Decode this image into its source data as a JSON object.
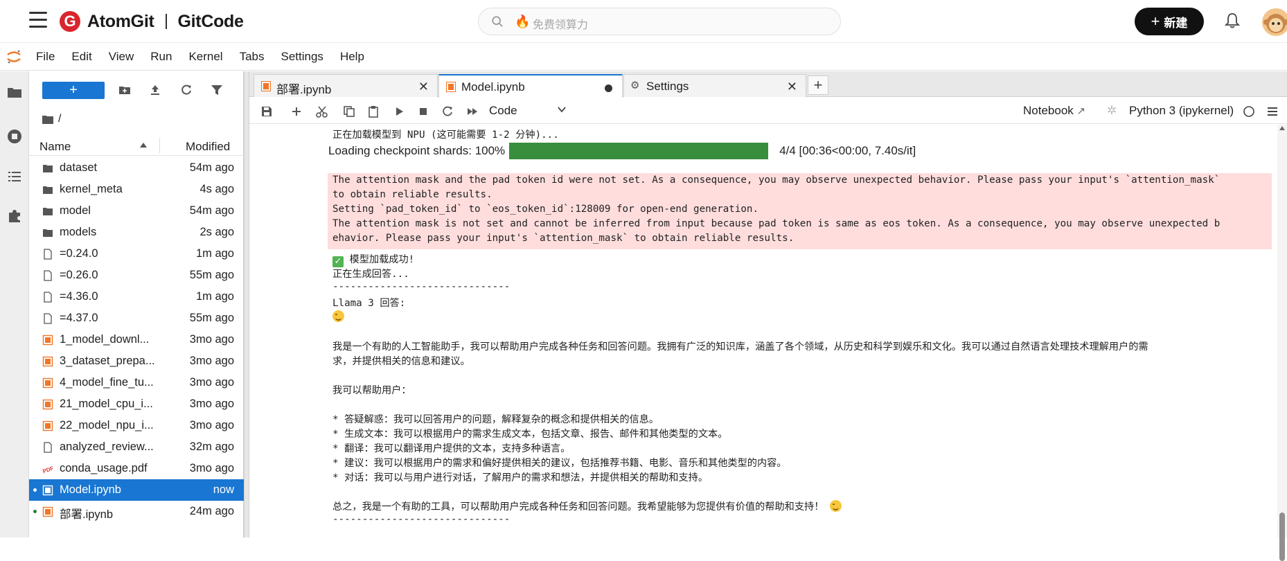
{
  "brand": {
    "name1": "AtomGit",
    "name2": "GitCode",
    "search_placeholder": "免费领算力",
    "new_button": "新建"
  },
  "menu": [
    "File",
    "Edit",
    "View",
    "Run",
    "Kernel",
    "Tabs",
    "Settings",
    "Help"
  ],
  "filebrowser": {
    "path": "/",
    "col_name": "Name",
    "col_modified": "Modified",
    "files": [
      {
        "name": "dataset",
        "modified": "54m ago",
        "type": "folder"
      },
      {
        "name": "kernel_meta",
        "modified": "4s ago",
        "type": "folder"
      },
      {
        "name": "model",
        "modified": "54m ago",
        "type": "folder"
      },
      {
        "name": "models",
        "modified": "2s ago",
        "type": "folder"
      },
      {
        "name": "=0.24.0",
        "modified": "1m ago",
        "type": "file"
      },
      {
        "name": "=0.26.0",
        "modified": "55m ago",
        "type": "file"
      },
      {
        "name": "=4.36.0",
        "modified": "1m ago",
        "type": "file"
      },
      {
        "name": "=4.37.0",
        "modified": "55m ago",
        "type": "file"
      },
      {
        "name": "1_model_downl...",
        "modified": "3mo ago",
        "type": "notebook"
      },
      {
        "name": "3_dataset_prepa...",
        "modified": "3mo ago",
        "type": "notebook"
      },
      {
        "name": "4_model_fine_tu...",
        "modified": "3mo ago",
        "type": "notebook"
      },
      {
        "name": "21_model_cpu_i...",
        "modified": "3mo ago",
        "type": "notebook"
      },
      {
        "name": "22_model_npu_i...",
        "modified": "3mo ago",
        "type": "notebook"
      },
      {
        "name": "analyzed_review...",
        "modified": "32m ago",
        "type": "file"
      },
      {
        "name": "conda_usage.pdf",
        "modified": "3mo ago",
        "type": "pdf"
      },
      {
        "name": "Model.ipynb",
        "modified": "now",
        "type": "notebook",
        "selected": true
      },
      {
        "name": "部署.ipynb",
        "modified": "24m ago",
        "type": "notebook"
      }
    ]
  },
  "tabs": [
    {
      "label": "部署.ipynb",
      "icon": "notebook-icon"
    },
    {
      "label": "Model.ipynb",
      "icon": "notebook-icon",
      "active": true,
      "dirty": true
    },
    {
      "label": "Settings",
      "icon": "gear-icon"
    }
  ],
  "toolbar": {
    "cell_type": "Code",
    "notebook_label": "Notebook",
    "kernel_label": "Python 3 (ipykernel)"
  },
  "output": {
    "loading_line": "正在加载模型到 NPU (这可能需要 1-2 分钟)...",
    "progress_label": "Loading checkpoint shards: 100%",
    "progress_fraction": 1.0,
    "progress_stats": "4/4 [00:36<00:00,  7.40s/it]",
    "stderr": [
      "The attention mask and the pad token id were not set. As a consequence, you may observe unexpected behavior. Please pass your input's `attention_mask`",
      "to obtain reliable results.",
      "Setting `pad_token_id` to `eos_token_id`:128009 for open-end generation.",
      "The attention mask is not set and cannot be inferred from input because pad token is same as eos token. As a consequence, you may observe unexpected b",
      "ehavior. Please pass your input's `attention_mask` to obtain reliable results."
    ],
    "success": "模型加载成功!",
    "generating": "正在生成回答...",
    "divider": "------------------------------",
    "answer_label": "Llama 3 回答:",
    "para1a": "我是一个有助的人工智能助手，我可以帮助用户完成各种任务和回答问题。我拥有广泛的知识库，涵盖了各个领域，从历史和科学到娱乐和文化。我可以通过自然语言处理技术理解用户的需",
    "para1b": "求，并提供相关的信息和建议。",
    "para2": "我可以帮助用户：",
    "bullets": [
      "* 答疑解惑：我可以回答用户的问题，解释复杂的概念和提供相关的信息。",
      "* 生成文本：我可以根据用户的需求生成文本，包括文章、报告、邮件和其他类型的文本。",
      "* 翻译：我可以翻译用户提供的文本，支持多种语言。",
      "* 建议：我可以根据用户的需求和偏好提供相关的建议，包括推荐书籍、电影、音乐和其他类型的内容。",
      "* 对话：我可以与用户进行对话，了解用户的需求和想法，并提供相关的帮助和支持。"
    ],
    "summary": "总之，我是一个有助的工具，可以帮助用户完成各种任务和回答问题。我希望能够为您提供有价值的帮助和支持！",
    "divider2": "------------------------------"
  }
}
